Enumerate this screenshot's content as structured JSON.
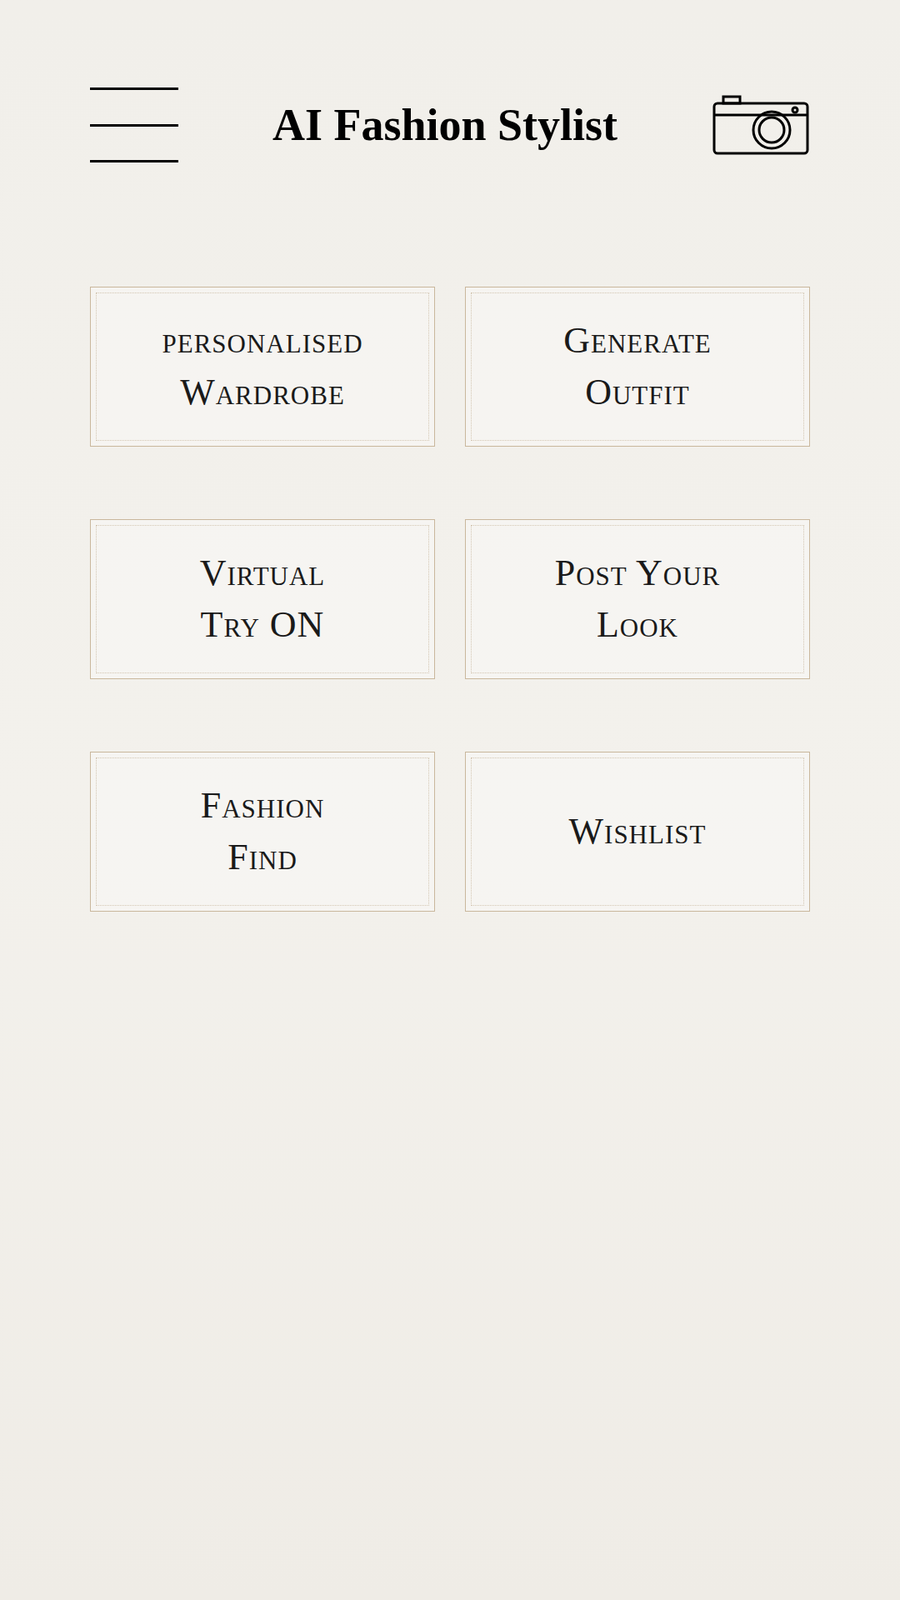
{
  "header": {
    "title": "AI Fashion Stylist"
  },
  "tiles": [
    {
      "lines": [
        "personalised",
        "Wardrobe"
      ]
    },
    {
      "lines": [
        "Generate",
        "Outfit"
      ]
    },
    {
      "lines": [
        "Virtual",
        "Try ON"
      ]
    },
    {
      "lines": [
        "Post Your",
        "Look"
      ]
    },
    {
      "lines": [
        "Fashion",
        "Find"
      ]
    },
    {
      "lines": [
        "Wishlist"
      ]
    }
  ]
}
